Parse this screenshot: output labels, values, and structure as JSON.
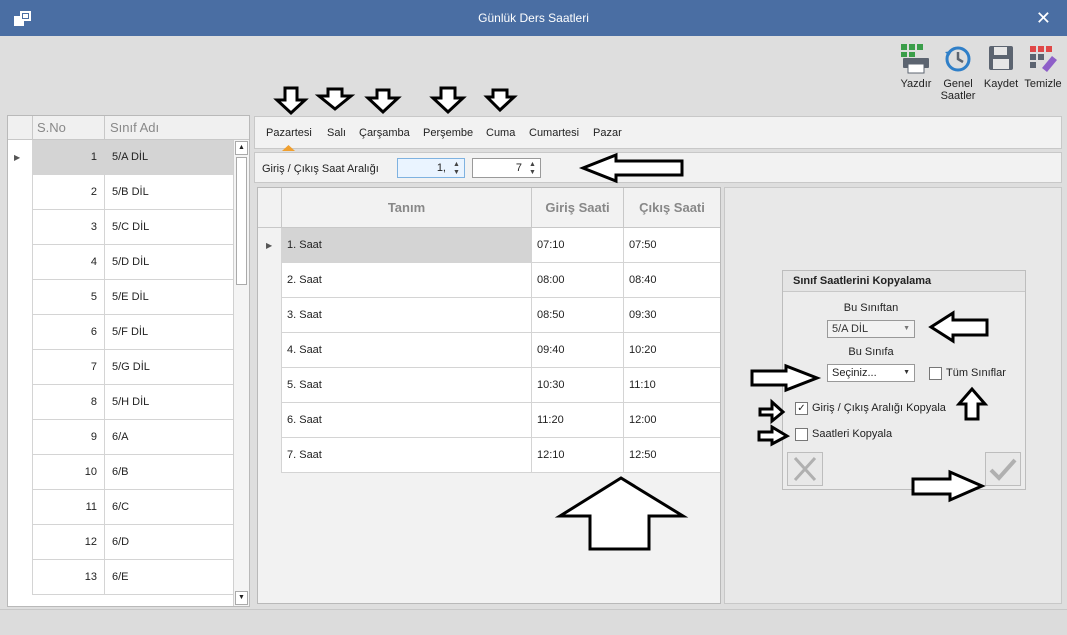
{
  "window": {
    "title": "Günlük Ders Saatleri",
    "close_glyph": "✕"
  },
  "toolbar": [
    {
      "label": "Yazdır",
      "icon": "printer-icon"
    },
    {
      "label": "Genel Saatler",
      "icon": "history-clock-icon"
    },
    {
      "label": "Kaydet",
      "icon": "floppy-disk-icon"
    },
    {
      "label": "Temizle",
      "icon": "clear-grid-icon"
    }
  ],
  "class_grid": {
    "headers": [
      "S.No",
      "Sınıf Adı"
    ],
    "rows": [
      {
        "no": "1",
        "name": "5/A DİL"
      },
      {
        "no": "2",
        "name": "5/B DİL"
      },
      {
        "no": "3",
        "name": "5/C DİL"
      },
      {
        "no": "4",
        "name": "5/D DİL"
      },
      {
        "no": "5",
        "name": "5/E DİL"
      },
      {
        "no": "6",
        "name": "5/F DİL"
      },
      {
        "no": "7",
        "name": "5/G DİL"
      },
      {
        "no": "8",
        "name": "5/H DİL"
      },
      {
        "no": "9",
        "name": "6/A"
      },
      {
        "no": "10",
        "name": "6/B"
      },
      {
        "no": "11",
        "name": "6/C"
      },
      {
        "no": "12",
        "name": "6/D"
      },
      {
        "no": "13",
        "name": "6/E"
      }
    ],
    "selected_index": 0
  },
  "day_tabs": [
    "Pazartesi",
    "Salı",
    "Çarşamba",
    "Perşembe",
    "Cuma",
    "Cumartesi",
    "Pazar"
  ],
  "active_tab": "Pazartesi",
  "range": {
    "label": "Giriş / Çıkış Saat Aralığı",
    "from": "1,",
    "to": "7"
  },
  "hours_grid": {
    "headers": [
      "Tanım",
      "Giriş Saati",
      "Çıkış Saati"
    ],
    "rows": [
      {
        "name": "1. Saat",
        "in": "07:10",
        "out": "07:50"
      },
      {
        "name": "2. Saat",
        "in": "08:00",
        "out": "08:40"
      },
      {
        "name": "3. Saat",
        "in": "08:50",
        "out": "09:30"
      },
      {
        "name": "4. Saat",
        "in": "09:40",
        "out": "10:20"
      },
      {
        "name": "5. Saat",
        "in": "10:30",
        "out": "11:10"
      },
      {
        "name": "6. Saat",
        "in": "11:20",
        "out": "12:00"
      },
      {
        "name": "7. Saat",
        "in": "12:10",
        "out": "12:50"
      }
    ]
  },
  "copy_box": {
    "title": "Sınıf Saatlerini Kopyalama",
    "from_label": "Bu Sınıftan",
    "from_value": "5/A DİL",
    "to_label": "Bu Sınıfa",
    "to_value": "Seçiniz...",
    "all_classes_label": "Tüm Sınıflar",
    "all_classes_checked": false,
    "copy_range_label": "Giriş / Çıkış Aralığı Kopyala",
    "copy_range_checked": true,
    "copy_hours_label": "Saatleri Kopyala",
    "copy_hours_checked": false
  },
  "colors": {
    "titlebar": "#4a6ea3",
    "accent_tab": "#f0a030",
    "selected_row": "#d4d4d4"
  }
}
